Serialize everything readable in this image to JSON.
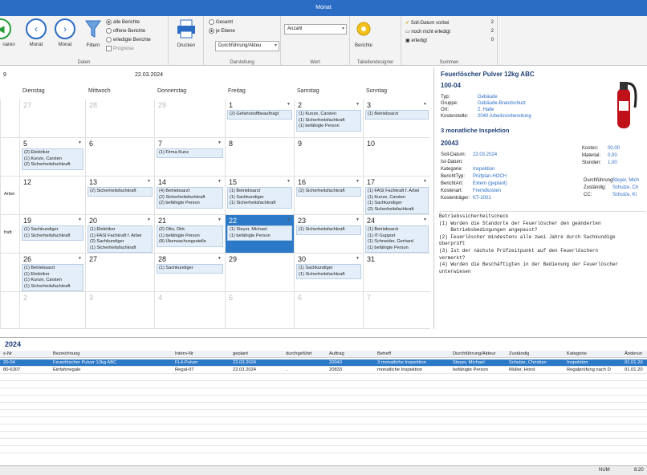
{
  "title": "Monat",
  "ribbon": {
    "btn_cut": "naren",
    "btn_prev": "Monat",
    "btn_next": "Monat",
    "btn_filter": "Filtern",
    "radios_filter": [
      "alle Berichte",
      "offene Berichte",
      "erledigte Berichte",
      "Prognose"
    ],
    "group_daten": "Daten",
    "btn_print": "Drucken",
    "radios_view": [
      "Gesamt",
      "je Ebene"
    ],
    "select_display": "Durchführung/Akteu",
    "group_darstellung": "Darstellung",
    "select_value": "Anzahl",
    "group_wert": "Wert",
    "btn_reports": "Berichte",
    "group_tabelle": "Tabellendesigner",
    "sum_rows": [
      {
        "label": "Soll-Datum vorbei",
        "n": "2"
      },
      {
        "label": "noch nicht erledigt",
        "n": "2"
      },
      {
        "label": "erledigt",
        "n": "0"
      }
    ],
    "group_summen": "Summen",
    "colors": {
      "accent": "#2b6cc4",
      "selected": "#2c79c8"
    }
  },
  "calendar": {
    "left_marker": "9",
    "date": "22.03.2024",
    "days": [
      "Dienstag",
      "Mittwoch",
      "Donnerstag",
      "Freitag",
      "Samstag",
      "Sonntag"
    ],
    "weeks": [
      [
        {
          "n": "",
          "ev": ""
        },
        {
          "n": "27",
          "ev": "",
          "gray": true
        },
        {
          "n": "28",
          "ev": "",
          "gray": true
        },
        {
          "n": "29",
          "ev": "",
          "gray": true
        },
        {
          "n": "1",
          "ev": "(2) Gefahrstoffbeauftragt"
        },
        {
          "n": "2",
          "ev": "(1) Kunze, Carsten\n(1) Sicherheitsfachkraft\n(1) befähigte Person"
        },
        {
          "n": "3",
          "ev": "(1) Betriebsarzt"
        }
      ],
      [
        {
          "n": "",
          "ev": ""
        },
        {
          "n": "5",
          "ev": "(2) Elektriker\n(1) Kunze, Carsten\n(2) Sicherheitsfachkraft"
        },
        {
          "n": "6",
          "ev": ""
        },
        {
          "n": "7",
          "ev": "(1) Firma Kunz"
        },
        {
          "n": "8",
          "ev": ""
        },
        {
          "n": "9",
          "ev": ""
        },
        {
          "n": "10",
          "ev": ""
        }
      ],
      [
        {
          "n": "",
          "ev": "Arbei"
        },
        {
          "n": "12",
          "ev": ""
        },
        {
          "n": "13",
          "ev": "(2) Sicherheitsfachkraft"
        },
        {
          "n": "14",
          "ev": "(4) Betriebsarzt\n(2) Sicherheitsfachkraft\n(2) befähigte Person"
        },
        {
          "n": "15",
          "ev": "(1) Betriebsarzt\n(1) Sachkundiger\n(1) Sicherheitsfachkraft"
        },
        {
          "n": "16",
          "ev": "(2) Sicherheitsfachkraft"
        },
        {
          "n": "17",
          "ev": "(1) FASI Fachkraft f. Arbei\n(1) Kunze, Carsten\n(1) Sachkundiger\n(2) Sicherheitsfachkraft"
        }
      ],
      [
        {
          "n": "",
          "ev": "fraft"
        },
        {
          "n": "19",
          "ev": "(1) Sachkundiger\n(1) Sicherheitsfachkraft"
        },
        {
          "n": "20",
          "ev": "(1) Elektriker\n(1) FASI Fachkraft f. Arbei\n(2) Sachkundiger\n(1) Sicherheitsfachkraft"
        },
        {
          "n": "21",
          "ev": "(2) Otto, Dirk\n(1) befähigte Person\n(8) Überwachungsstelle"
        },
        {
          "n": "22",
          "ev": "(1) Steyer, Michael\n(1) befähigte Person",
          "selected": true
        },
        {
          "n": "23",
          "ev": "(1) Sicherheitsfachkraft"
        },
        {
          "n": "24",
          "ev": "(1) Betriebsarzt\n(1) IT-Support\n(1) Schneider, Gerhard\n(1) befähigte Person"
        }
      ],
      [
        {
          "n": "",
          "ev": ""
        },
        {
          "n": "26",
          "ev": "(1) Betriebsarzt\n(1) Elektriker\n(1) Kunze, Carsten\n(1) Sicherheitsfachkraft"
        },
        {
          "n": "27",
          "ev": ""
        },
        {
          "n": "28",
          "ev": "(1) Sachkundiger"
        },
        {
          "n": "29",
          "ev": ""
        },
        {
          "n": "30",
          "ev": "(1) Sachkundiger\n(1) Sicherheitsfachkraft"
        },
        {
          "n": "31",
          "ev": ""
        }
      ],
      [
        {
          "n": "",
          "ev": ""
        },
        {
          "n": "2",
          "ev": "",
          "gray": true
        },
        {
          "n": "3",
          "ev": "",
          "gray": true
        },
        {
          "n": "4",
          "ev": "",
          "gray": true
        },
        {
          "n": "5",
          "ev": "",
          "gray": true
        },
        {
          "n": "6",
          "ev": "",
          "gray": true
        },
        {
          "n": "7",
          "ev": "",
          "gray": true
        }
      ]
    ]
  },
  "detail": {
    "title": "Feuerlöscher Pulver 12kg ABC",
    "id": "100-04",
    "fields_left": [
      {
        "k": "Typ:",
        "v": "Gebäude"
      },
      {
        "k": "Gruppe:",
        "v": "Gebäude-Brandschutz"
      },
      {
        "k": "Ort:",
        "v": "2. Halle"
      },
      {
        "k": "Kostenstelle:",
        "v": "2040 Arbeitsvorbereitung"
      }
    ],
    "inspection": "3 monatliche Inspektion",
    "order": "20043",
    "fields2": [
      {
        "k": "Soll-Datum:",
        "v": "22.03.2024"
      },
      {
        "k": "Ist-Datum:",
        "v": ""
      },
      {
        "k": "Kategorie:",
        "v": "Inspektion"
      },
      {
        "k": "BerichtTyp:",
        "v": "Prüfplan-HOCH"
      },
      {
        "k": "BerichtArt:",
        "v": "Extern (geplant)"
      },
      {
        "k": "Kostenart:",
        "v": "Fremdkosten"
      },
      {
        "k": "Kostenträger:",
        "v": "KT-2001"
      }
    ],
    "costs": [
      {
        "k": "Kosten:",
        "v": "00,00"
      },
      {
        "k": "Material:",
        "v": "0,00"
      },
      {
        "k": "Stunden:",
        "v": "1,00"
      }
    ],
    "people": [
      {
        "k": "Durchführung:",
        "v": "Steyer, Mich"
      },
      {
        "k": "Zuständig:",
        "v": "Schulze, Ch"
      },
      {
        "k": "CC:",
        "v": "Schulze, Kl"
      }
    ],
    "text": "Betriebssicherheitscheck\n(1) Wurden die Standorte der Feuerlöscher den geänderten\n    Betriebsbedingungen angepasst?\n(2) Feuerlöscher mindestens alle zwei Jahre durch Sachkundige\nüberprüft\n(3) Ist der nächste Prüfzeitpunkt auf den Feuerlöschern\nvermerkt?\n(4) Wurden die Beschäftigten in der Bedienung der Feuerlöscher\nunterwiesen"
  },
  "table": {
    "title": "2024",
    "headers": [
      "s-Nr",
      "Bezeichnung",
      "Intern-Nr",
      "geplant",
      "durchgeführt",
      "Auftrag",
      "Betreff",
      "Durchführung/Akteur",
      "Zuständig",
      "Kategorie",
      "Änderun"
    ],
    "rows": [
      [
        "20-04",
        "Feuerlöscher Pulver 12kg ABC",
        "FL4-Pulver",
        "22.03.2024",
        "",
        "20043",
        "3 monatliche Inspektion",
        "Steyer, Michael",
        "Schulze, Christian",
        "Inspektion",
        "01.01.20"
      ],
      [
        "80-6307",
        "Einfahrregale",
        "Regal-07",
        "22.03.2024",
        "..",
        "20833",
        "monatliche Inspektion",
        "befähigte Person",
        "Müller, Horst",
        "Regalprüfung nach D",
        "01.01.20"
      ]
    ]
  },
  "status": {
    "num": "NUM",
    "clock": "8:20"
  }
}
